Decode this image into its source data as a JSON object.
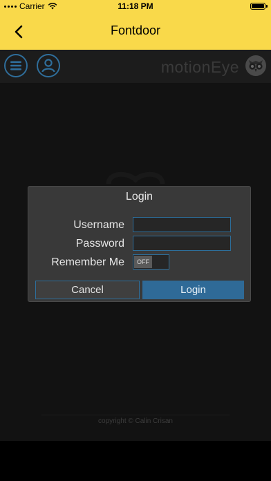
{
  "status_bar": {
    "carrier": "Carrier",
    "time": "11:18 PM"
  },
  "nav": {
    "title": "Fontdoor"
  },
  "motioneye": {
    "brand": "motionEye",
    "copyright": "copyright © Calin Crisan"
  },
  "login_dialog": {
    "title": "Login",
    "username_label": "Username",
    "password_label": "Password",
    "remember_label": "Remember Me",
    "username_value": "",
    "password_value": "",
    "remember_state": "OFF",
    "cancel_label": "Cancel",
    "login_label": "Login"
  },
  "colors": {
    "nav_background": "#f9d94a",
    "accent": "#2f6a97",
    "page_background": "#121212",
    "dialog_background": "#393939"
  }
}
